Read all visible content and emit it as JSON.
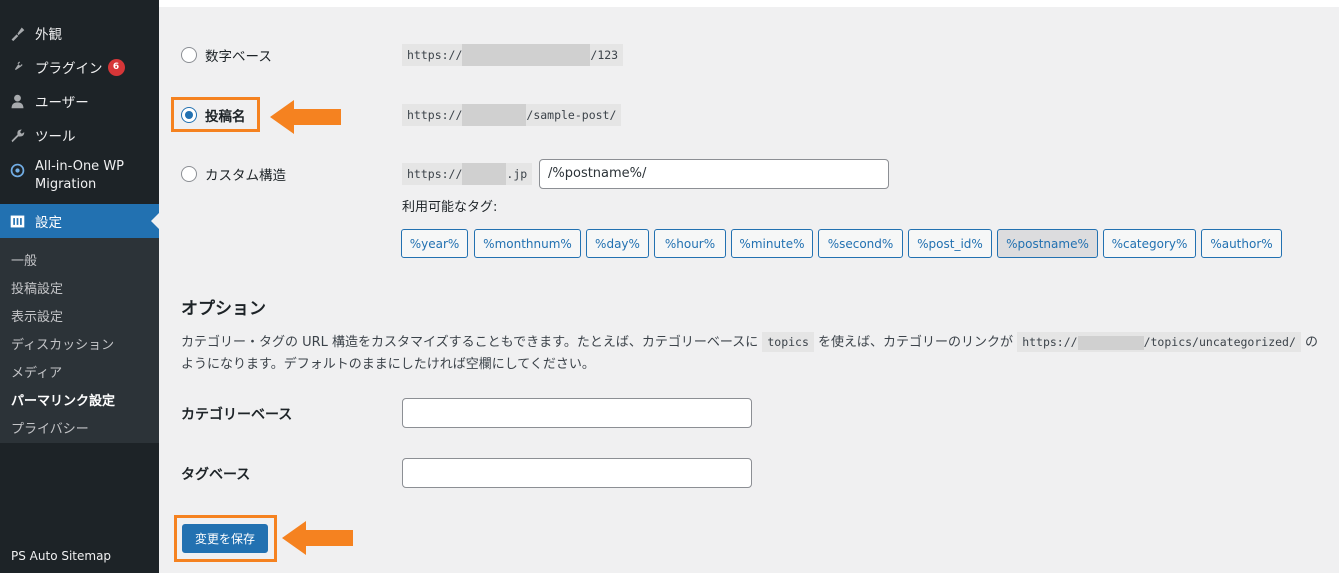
{
  "sidebar": {
    "items": [
      {
        "label": "外観",
        "icon": "brush-icon"
      },
      {
        "label": "プラグイン",
        "icon": "plugin-icon",
        "badge": "6"
      },
      {
        "label": "ユーザー",
        "icon": "user-icon"
      },
      {
        "label": "ツール",
        "icon": "wrench-icon"
      },
      {
        "label_line1": "All-in-One WP",
        "label_line2": "Migration",
        "icon": "migration-icon"
      },
      {
        "label": "設定",
        "icon": "settings-icon"
      }
    ],
    "submenu": [
      "一般",
      "投稿設定",
      "表示設定",
      "ディスカッション",
      "メディア",
      "パーマリンク設定",
      "プライバシー"
    ],
    "ps_auto": "PS Auto Sitemap"
  },
  "permalink": {
    "numeric": {
      "label": "数字ベース",
      "prefix": "https://",
      "suffix": "/123"
    },
    "postname": {
      "label": "投稿名",
      "prefix": "https://",
      "suffix": "/sample-post/"
    },
    "custom": {
      "label": "カスタム構造",
      "prefix": "https://",
      "suffix": ".jp",
      "value": "/%postname%/"
    }
  },
  "tags": {
    "label": "利用可能なタグ:",
    "items": [
      "%year%",
      "%monthnum%",
      "%day%",
      "%hour%",
      "%minute%",
      "%second%",
      "%post_id%",
      "%postname%",
      "%category%",
      "%author%"
    ]
  },
  "options": {
    "heading": "オプション",
    "desc_part1": "カテゴリー・タグの URL 構造をカスタマイズすることもできます。たとえば、カテゴリーベースに",
    "desc_code1": "topics",
    "desc_part2": "を使えば、カテゴリーのリンクが",
    "desc_code2_prefix": "https://",
    "desc_code2_suffix": "/topics/uncategorized/",
    "desc_part3": "の",
    "desc_line2": "ようになります。デフォルトのままにしたければ空欄にしてください。",
    "category_base_label": "カテゴリーベース",
    "tag_base_label": "タグベース",
    "category_base_value": "",
    "tag_base_value": ""
  },
  "save_label": "変更を保存",
  "colors": {
    "accent": "#2271b1",
    "highlight": "#f58220",
    "sidebar": "#1d2327"
  }
}
